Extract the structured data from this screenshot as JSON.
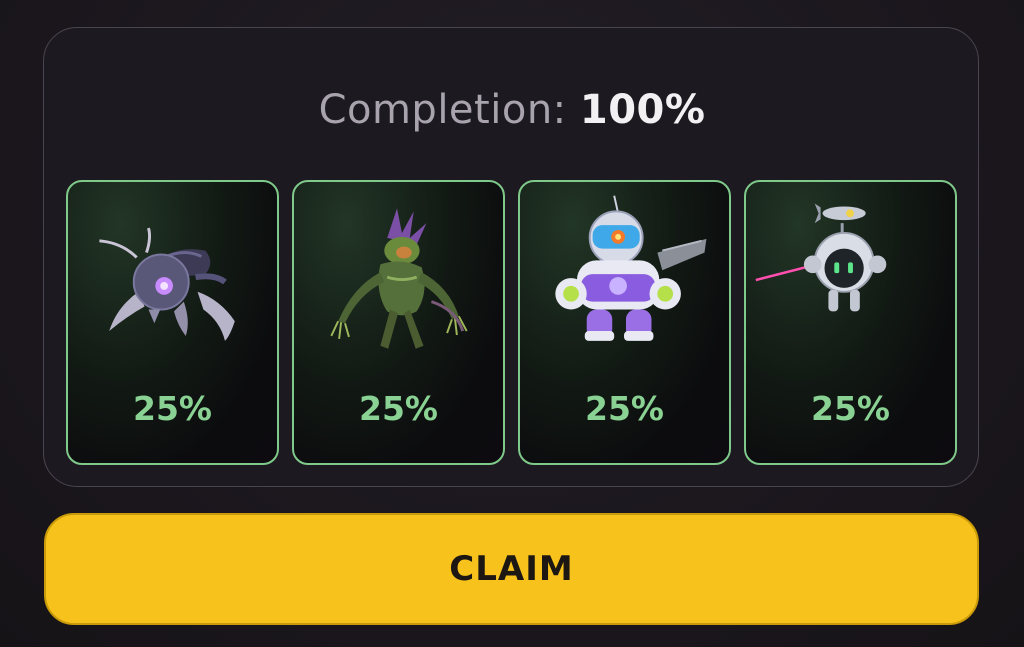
{
  "completion": {
    "label": "Completion:",
    "value": "100%"
  },
  "cards": [
    {
      "name": "spider-bot",
      "percent": "25%",
      "icon": "robot-spider-icon"
    },
    {
      "name": "plant-mutant",
      "percent": "25%",
      "icon": "plant-monster-icon"
    },
    {
      "name": "astronaut-mech",
      "percent": "25%",
      "icon": "astronaut-robot-icon"
    },
    {
      "name": "drone-bot",
      "percent": "25%",
      "icon": "flying-drone-icon"
    }
  ],
  "claim_button": {
    "label": "CLAIM"
  },
  "colors": {
    "accent_green": "#8ad293",
    "card_border": "#7fc98a",
    "claim_yellow": "#f7c21b",
    "background": "#1b171d"
  }
}
